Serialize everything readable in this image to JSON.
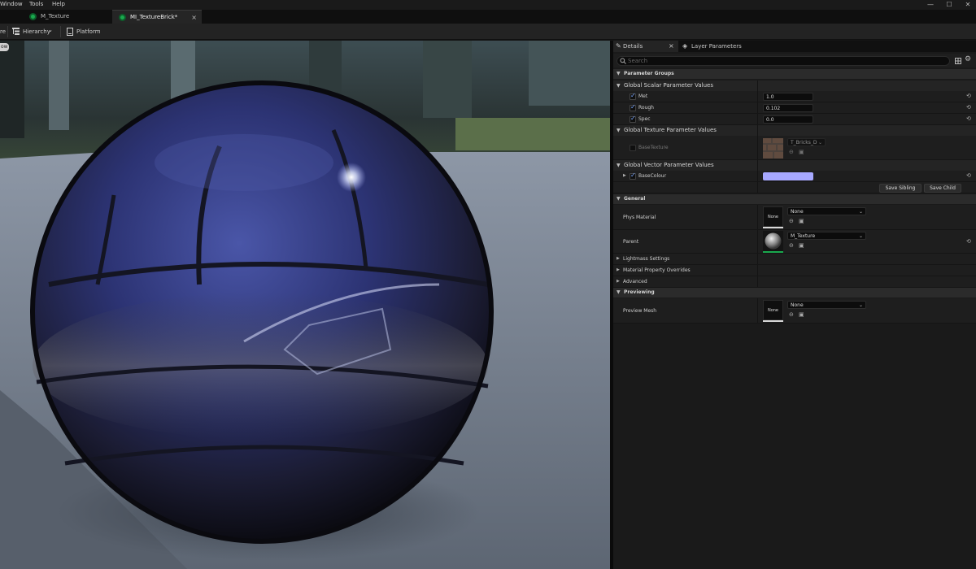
{
  "menu": {
    "items": [
      "Window",
      "Tools",
      "Help"
    ]
  },
  "window_controls": {
    "minimize": "—",
    "maximize": "☐",
    "close": "✕"
  },
  "tabs": [
    {
      "label": "M_Texture",
      "active": false
    },
    {
      "label": "MI_TextureBrick*",
      "active": true
    }
  ],
  "tab_close": "×",
  "toolbar": {
    "partial_label": "re",
    "hierarchy": "Hierarchy",
    "hierarchy_arrow": "⌄",
    "platform_stats": "Platform Stats"
  },
  "viewport": {
    "badge": "ow"
  },
  "panel": {
    "tabs": [
      {
        "label": "Details",
        "close": "×"
      },
      {
        "label": "Layer Parameters"
      }
    ],
    "search_placeholder": "Search",
    "parameter_groups": {
      "title": "Parameter Groups",
      "scalar": {
        "title": "Global Scalar Parameter Values",
        "params": [
          {
            "name": "Met",
            "value": "1.0"
          },
          {
            "name": "Rough",
            "value": "0.102"
          },
          {
            "name": "Spec",
            "value": "0.0"
          }
        ]
      },
      "texture": {
        "title": "Global Texture Parameter Values",
        "param": {
          "name": "BaseTexture",
          "asset": "T_Bricks_D"
        }
      },
      "vector": {
        "title": "Global Vector Parameter Values",
        "param": {
          "name": "BaseColour",
          "color": "#a7a8ff"
        }
      },
      "save_sibling": "Save Sibling",
      "save_child": "Save Child"
    },
    "general": {
      "title": "General",
      "phys_material": {
        "label": "Phys Material",
        "thumb": "None",
        "value": "None"
      },
      "parent": {
        "label": "Parent",
        "value": "M_Texture"
      },
      "collapsed": [
        "Lightmass Settings",
        "Material Property Overrides",
        "Advanced"
      ]
    },
    "previewing": {
      "title": "Previewing",
      "preview_mesh": {
        "label": "Preview Mesh",
        "thumb": "None",
        "value": "None"
      }
    },
    "icons": {
      "reset": "⟲",
      "caret_down": "▼",
      "caret_right": "▶",
      "dropdown": "⌄",
      "browse": "⊖",
      "folder": "▣"
    }
  }
}
